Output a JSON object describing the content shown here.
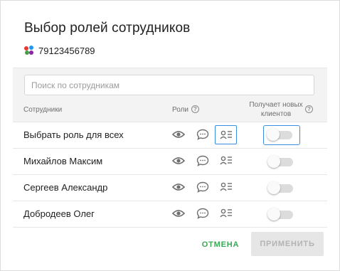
{
  "dialog": {
    "title": "Выбор ролей сотрудников",
    "phone": "79123456789",
    "logo_colors": [
      "#e53935",
      "#2196f3",
      "#43a047",
      "#8e24aa"
    ]
  },
  "search": {
    "placeholder": "Поиск по сотрудникам",
    "value": ""
  },
  "columns": {
    "employees": "Сотрудники",
    "roles": "Роли",
    "new_clients_line1": "Получает новых",
    "new_clients_line2": "клиентов"
  },
  "rows": [
    {
      "label": "Выбрать роль для всех",
      "new_clients": false,
      "selected_role": "card"
    },
    {
      "label": "Михайлов Максим",
      "new_clients": false
    },
    {
      "label": "Сергеев Александр",
      "new_clients": false
    },
    {
      "label": "Добродеев Олег",
      "new_clients": false
    }
  ],
  "role_icons": [
    "eye-icon",
    "chat-bubble-icon",
    "contact-card-icon"
  ],
  "footer": {
    "cancel_label": "ОТМЕНА",
    "apply_label": "ПРИМЕНИТЬ"
  },
  "colors": {
    "accent": "#3aaa55",
    "selection": "#3b8fe0"
  }
}
